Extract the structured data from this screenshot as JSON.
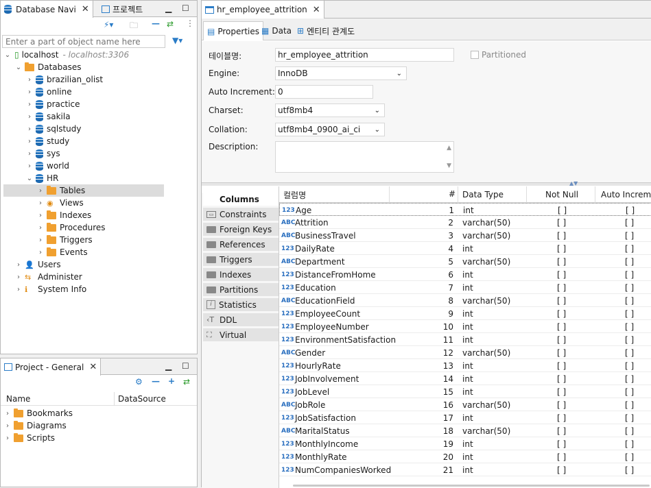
{
  "nav_panel": {
    "tabs": [
      {
        "label": "Database Navi"
      },
      {
        "label": "프로젝트"
      }
    ],
    "search_placeholder": "Enter a part of object name here"
  },
  "tree": {
    "connection": {
      "label": "localhost",
      "host": "- localhost:3306"
    },
    "databases_label": "Databases",
    "dbs": [
      "brazilian_olist",
      "online",
      "practice",
      "sakila",
      "sqlstudy",
      "study",
      "sys",
      "world",
      "HR"
    ],
    "hr_children": [
      "Tables",
      "Views",
      "Indexes",
      "Procedures",
      "Triggers",
      "Events"
    ],
    "root_items": [
      "Users",
      "Administer",
      "System Info"
    ]
  },
  "project_panel": {
    "title": "Project - General",
    "col_name": "Name",
    "col_datasource": "DataSource",
    "items": [
      "Bookmarks",
      "Diagrams",
      "Scripts"
    ]
  },
  "editor": {
    "tab_title": "hr_employee_attrition",
    "subtabs": [
      "Properties",
      "Data",
      "엔티티 관계도"
    ]
  },
  "props": {
    "table_name_label": "테이블명:",
    "table_name": "hr_employee_attrition",
    "partitioned": "Partitioned",
    "engine_label": "Engine:",
    "engine": "InnoDB",
    "autoinc_label": "Auto Increment:",
    "autoinc": "0",
    "charset_label": "Charset:",
    "charset": "utf8mb4",
    "collation_label": "Collation:",
    "collation": "utf8mb4_0900_ai_ci",
    "description_label": "Description:"
  },
  "side_tabs": [
    "Columns",
    "Constraints",
    "Foreign Keys",
    "References",
    "Triggers",
    "Indexes",
    "Partitions",
    "Statistics",
    "DDL",
    "Virtual"
  ],
  "grid": {
    "headers": [
      "컬럼명",
      "#",
      "Data Type",
      "Not Null",
      "Auto Increme"
    ],
    "rows": [
      {
        "name": "Age",
        "num": "1",
        "type": "int",
        "nn": "[ ]",
        "ai": "[ ]",
        "t": "123"
      },
      {
        "name": "Attrition",
        "num": "2",
        "type": "varchar(50)",
        "nn": "[ ]",
        "ai": "[ ]",
        "t": "ABC"
      },
      {
        "name": "BusinessTravel",
        "num": "3",
        "type": "varchar(50)",
        "nn": "[ ]",
        "ai": "[ ]",
        "t": "ABC"
      },
      {
        "name": "DailyRate",
        "num": "4",
        "type": "int",
        "nn": "[ ]",
        "ai": "[ ]",
        "t": "123"
      },
      {
        "name": "Department",
        "num": "5",
        "type": "varchar(50)",
        "nn": "[ ]",
        "ai": "[ ]",
        "t": "ABC"
      },
      {
        "name": "DistanceFromHome",
        "num": "6",
        "type": "int",
        "nn": "[ ]",
        "ai": "[ ]",
        "t": "123"
      },
      {
        "name": "Education",
        "num": "7",
        "type": "int",
        "nn": "[ ]",
        "ai": "[ ]",
        "t": "123"
      },
      {
        "name": "EducationField",
        "num": "8",
        "type": "varchar(50)",
        "nn": "[ ]",
        "ai": "[ ]",
        "t": "ABC"
      },
      {
        "name": "EmployeeCount",
        "num": "9",
        "type": "int",
        "nn": "[ ]",
        "ai": "[ ]",
        "t": "123"
      },
      {
        "name": "EmployeeNumber",
        "num": "10",
        "type": "int",
        "nn": "[ ]",
        "ai": "[ ]",
        "t": "123"
      },
      {
        "name": "EnvironmentSatisfaction",
        "num": "11",
        "type": "int",
        "nn": "[ ]",
        "ai": "[ ]",
        "t": "123"
      },
      {
        "name": "Gender",
        "num": "12",
        "type": "varchar(50)",
        "nn": "[ ]",
        "ai": "[ ]",
        "t": "ABC"
      },
      {
        "name": "HourlyRate",
        "num": "13",
        "type": "int",
        "nn": "[ ]",
        "ai": "[ ]",
        "t": "123"
      },
      {
        "name": "JobInvolvement",
        "num": "14",
        "type": "int",
        "nn": "[ ]",
        "ai": "[ ]",
        "t": "123"
      },
      {
        "name": "JobLevel",
        "num": "15",
        "type": "int",
        "nn": "[ ]",
        "ai": "[ ]",
        "t": "123"
      },
      {
        "name": "JobRole",
        "num": "16",
        "type": "varchar(50)",
        "nn": "[ ]",
        "ai": "[ ]",
        "t": "ABC"
      },
      {
        "name": "JobSatisfaction",
        "num": "17",
        "type": "int",
        "nn": "[ ]",
        "ai": "[ ]",
        "t": "123"
      },
      {
        "name": "MaritalStatus",
        "num": "18",
        "type": "varchar(50)",
        "nn": "[ ]",
        "ai": "[ ]",
        "t": "ABC"
      },
      {
        "name": "MonthlyIncome",
        "num": "19",
        "type": "int",
        "nn": "[ ]",
        "ai": "[ ]",
        "t": "123"
      },
      {
        "name": "MonthlyRate",
        "num": "20",
        "type": "int",
        "nn": "[ ]",
        "ai": "[ ]",
        "t": "123"
      },
      {
        "name": "NumCompaniesWorked",
        "num": "21",
        "type": "int",
        "nn": "[ ]",
        "ai": "[ ]",
        "t": "123"
      }
    ]
  }
}
